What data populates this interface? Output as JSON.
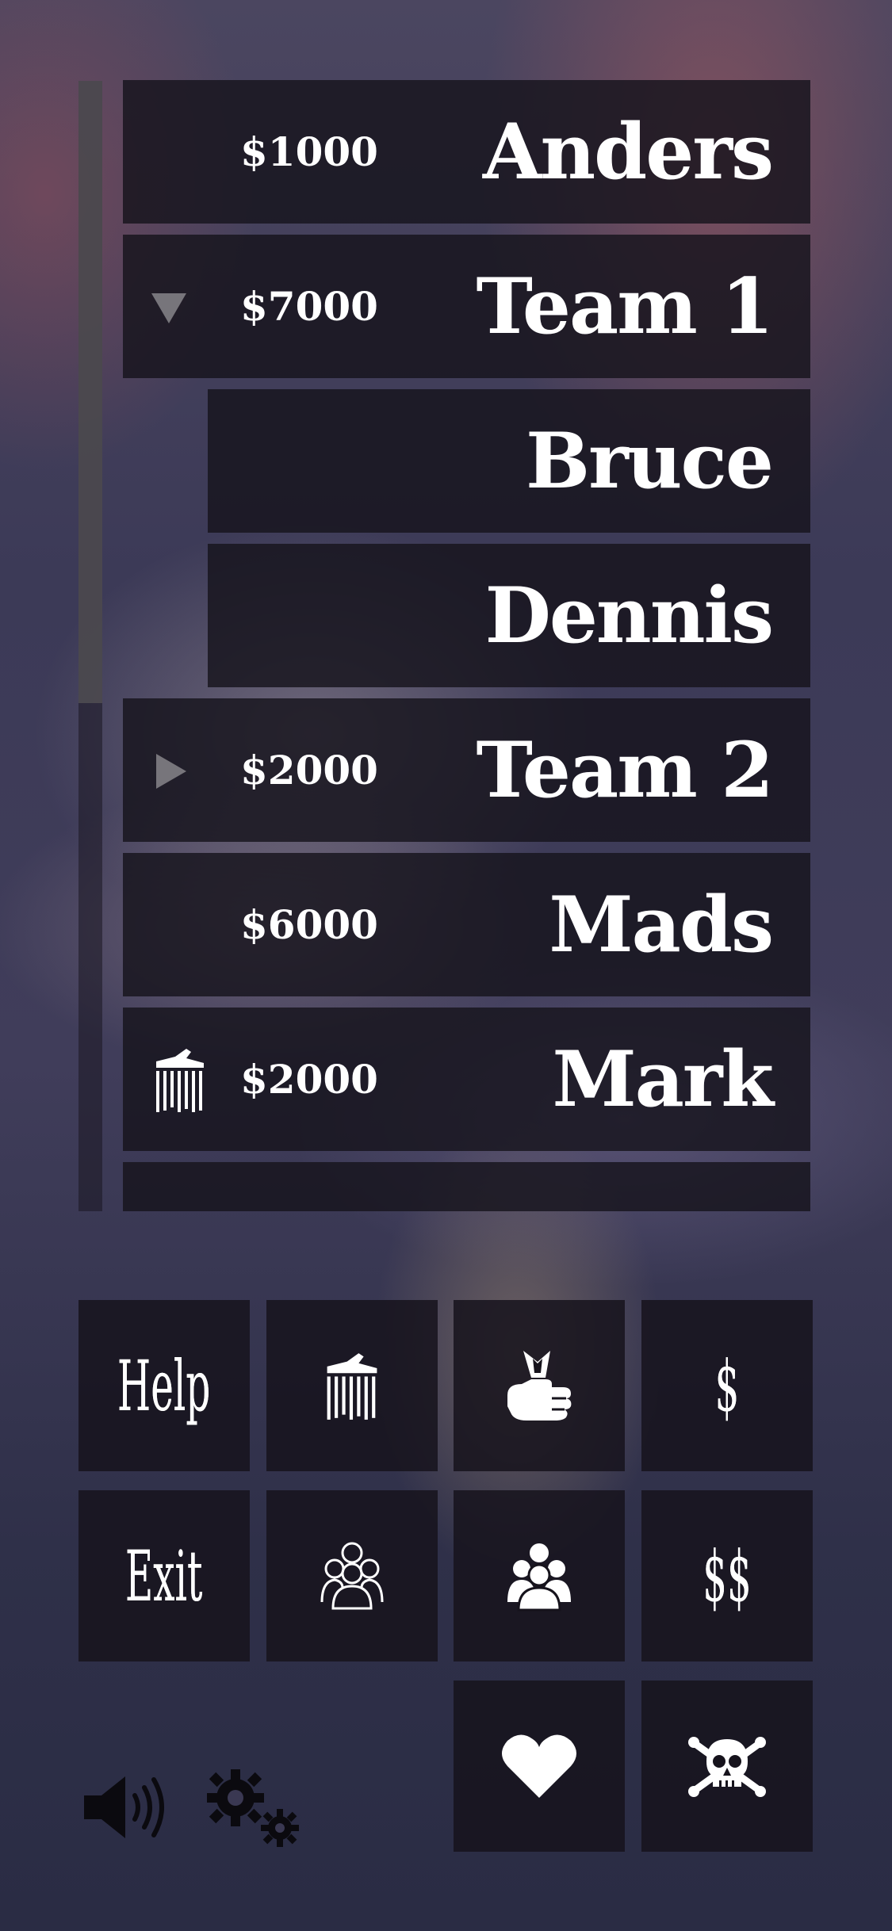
{
  "players": [
    {
      "name": "Anders",
      "amount": "$1000",
      "kind": "player"
    },
    {
      "name": "Team 1",
      "amount": "$7000",
      "kind": "team-expanded"
    },
    {
      "name": "Bruce",
      "amount": "",
      "kind": "member"
    },
    {
      "name": "Dennis",
      "amount": "",
      "kind": "member"
    },
    {
      "name": "Team 2",
      "amount": "$2000",
      "kind": "team-collapsed"
    },
    {
      "name": "Mads",
      "amount": "$6000",
      "kind": "player"
    },
    {
      "name": "Mark",
      "amount": "$2000",
      "kind": "player-bankrupt"
    }
  ],
  "buttons": {
    "help_label": "Help",
    "exit_label": "Exit",
    "dollar_label": "$",
    "double_dollar_label": "$$",
    "icons": [
      "bank-icon",
      "cash-hand-icon",
      "group-outline-icon",
      "group-filled-icon",
      "heart-icon",
      "skull-crossbones-icon",
      "speaker-icon",
      "gears-icon"
    ]
  },
  "colors": {
    "panel": "#16131c",
    "text": "#ffffff",
    "scrollbar": "#504e52"
  }
}
